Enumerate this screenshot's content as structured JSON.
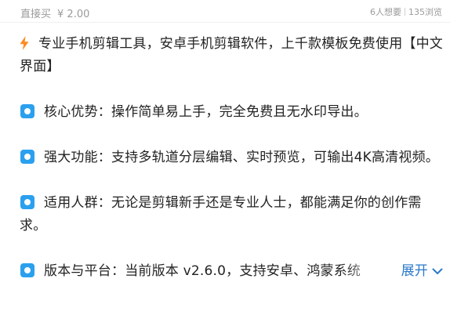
{
  "header": {
    "price_label": "直接买",
    "price": "¥ 2.00",
    "want_count": "6人想要",
    "view_count": "135浏览"
  },
  "description": {
    "intro": "专业手机剪辑工具，安卓手机剪辑软件，上千款模板免费使用【中文界面】",
    "bullets": [
      "核心优势：操作简单易上手，完全免费且无水印导出。",
      "强大功能：支持多轨道分层编辑、实时预览，可输出4K高清视频。",
      "适用人群：无论是剪辑新手还是专业人士，都能满足你的创作需求。",
      "版本与平台：当前版本 v2.6.0，支持安卓、鸿蒙系统"
    ],
    "expand_label": "展开"
  },
  "colors": {
    "accent": "#2a79c9",
    "bullet_icon": "#2aa0ee",
    "bolt_icon": "#ff8a1f",
    "muted_text": "#9a9a9a"
  },
  "icons": {
    "intro": "lightning-bolt-icon",
    "bullet": "blue-square-dot-icon",
    "expand": "chevron-down-icon"
  }
}
